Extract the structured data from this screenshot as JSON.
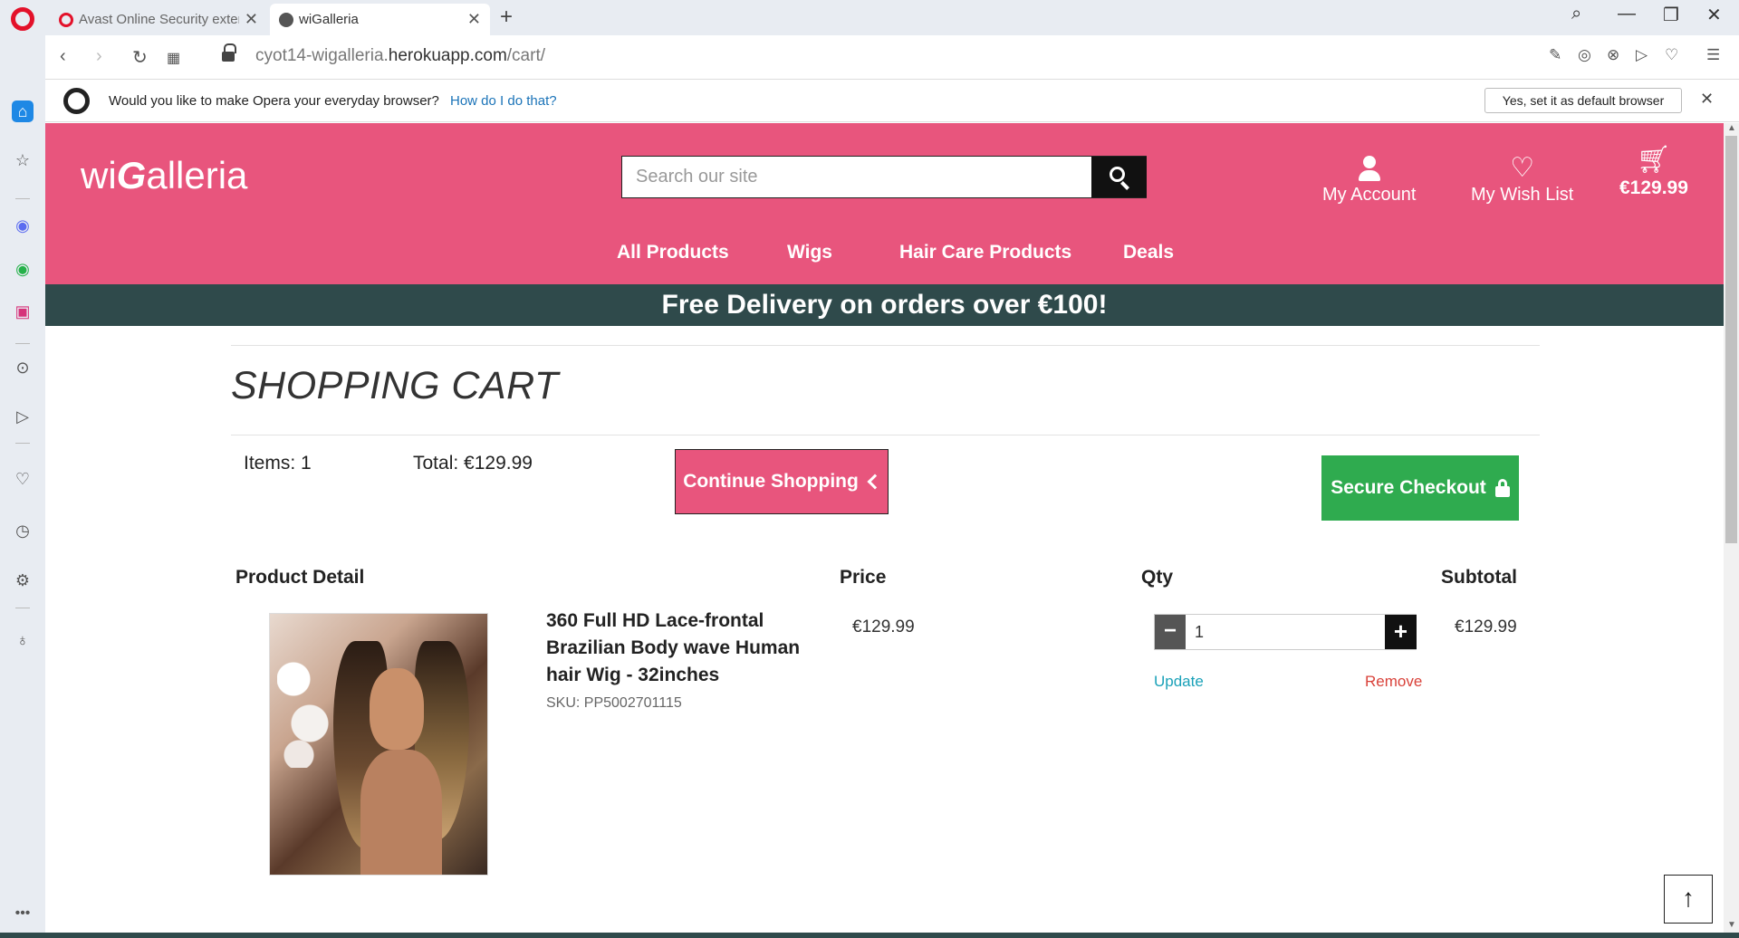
{
  "browser": {
    "tabs": [
      {
        "title": "Avast Online Security exten",
        "active": false
      },
      {
        "title": "wiGalleria",
        "active": true
      }
    ],
    "url_host": "cyot14-wigalleria.",
    "url_domain": "herokuapp.com",
    "url_path": "/cart/",
    "infobar": {
      "message": "Would you like to make Opera your everyday browser?",
      "link": "How do I do that?",
      "button": "Yes, set it as default browser"
    },
    "accent": "#e3112a"
  },
  "site": {
    "logo_prefix": "wi",
    "logo_g": "G",
    "logo_suffix": "alleria",
    "search_placeholder": "Search our site",
    "account_label": "My Account",
    "wishlist_label": "My Wish List",
    "cart_total": "€129.99",
    "nav": [
      "All Products",
      "Wigs",
      "Hair Care Products",
      "Deals"
    ],
    "banner": "Free Delivery on orders over €100!",
    "colors": {
      "brand_pink": "#e8557d",
      "banner_dark": "#2f4a4b",
      "checkout_green": "#2fab4f"
    }
  },
  "cart": {
    "title": "SHOPPING CART",
    "items_label": "Items: 1",
    "total_label": "Total: €129.99",
    "continue_label": "Continue Shopping",
    "checkout_label": "Secure Checkout",
    "columns": {
      "product": "Product Detail",
      "price": "Price",
      "qty": "Qty",
      "subtotal": "Subtotal"
    },
    "item": {
      "name": "360 Full HD Lace-frontal Brazilian Body wave Human hair Wig - 32inches",
      "sku": "SKU: PP5002701115",
      "price": "€129.99",
      "qty": "1",
      "update": "Update",
      "remove": "Remove",
      "subtotal": "€129.99"
    }
  }
}
